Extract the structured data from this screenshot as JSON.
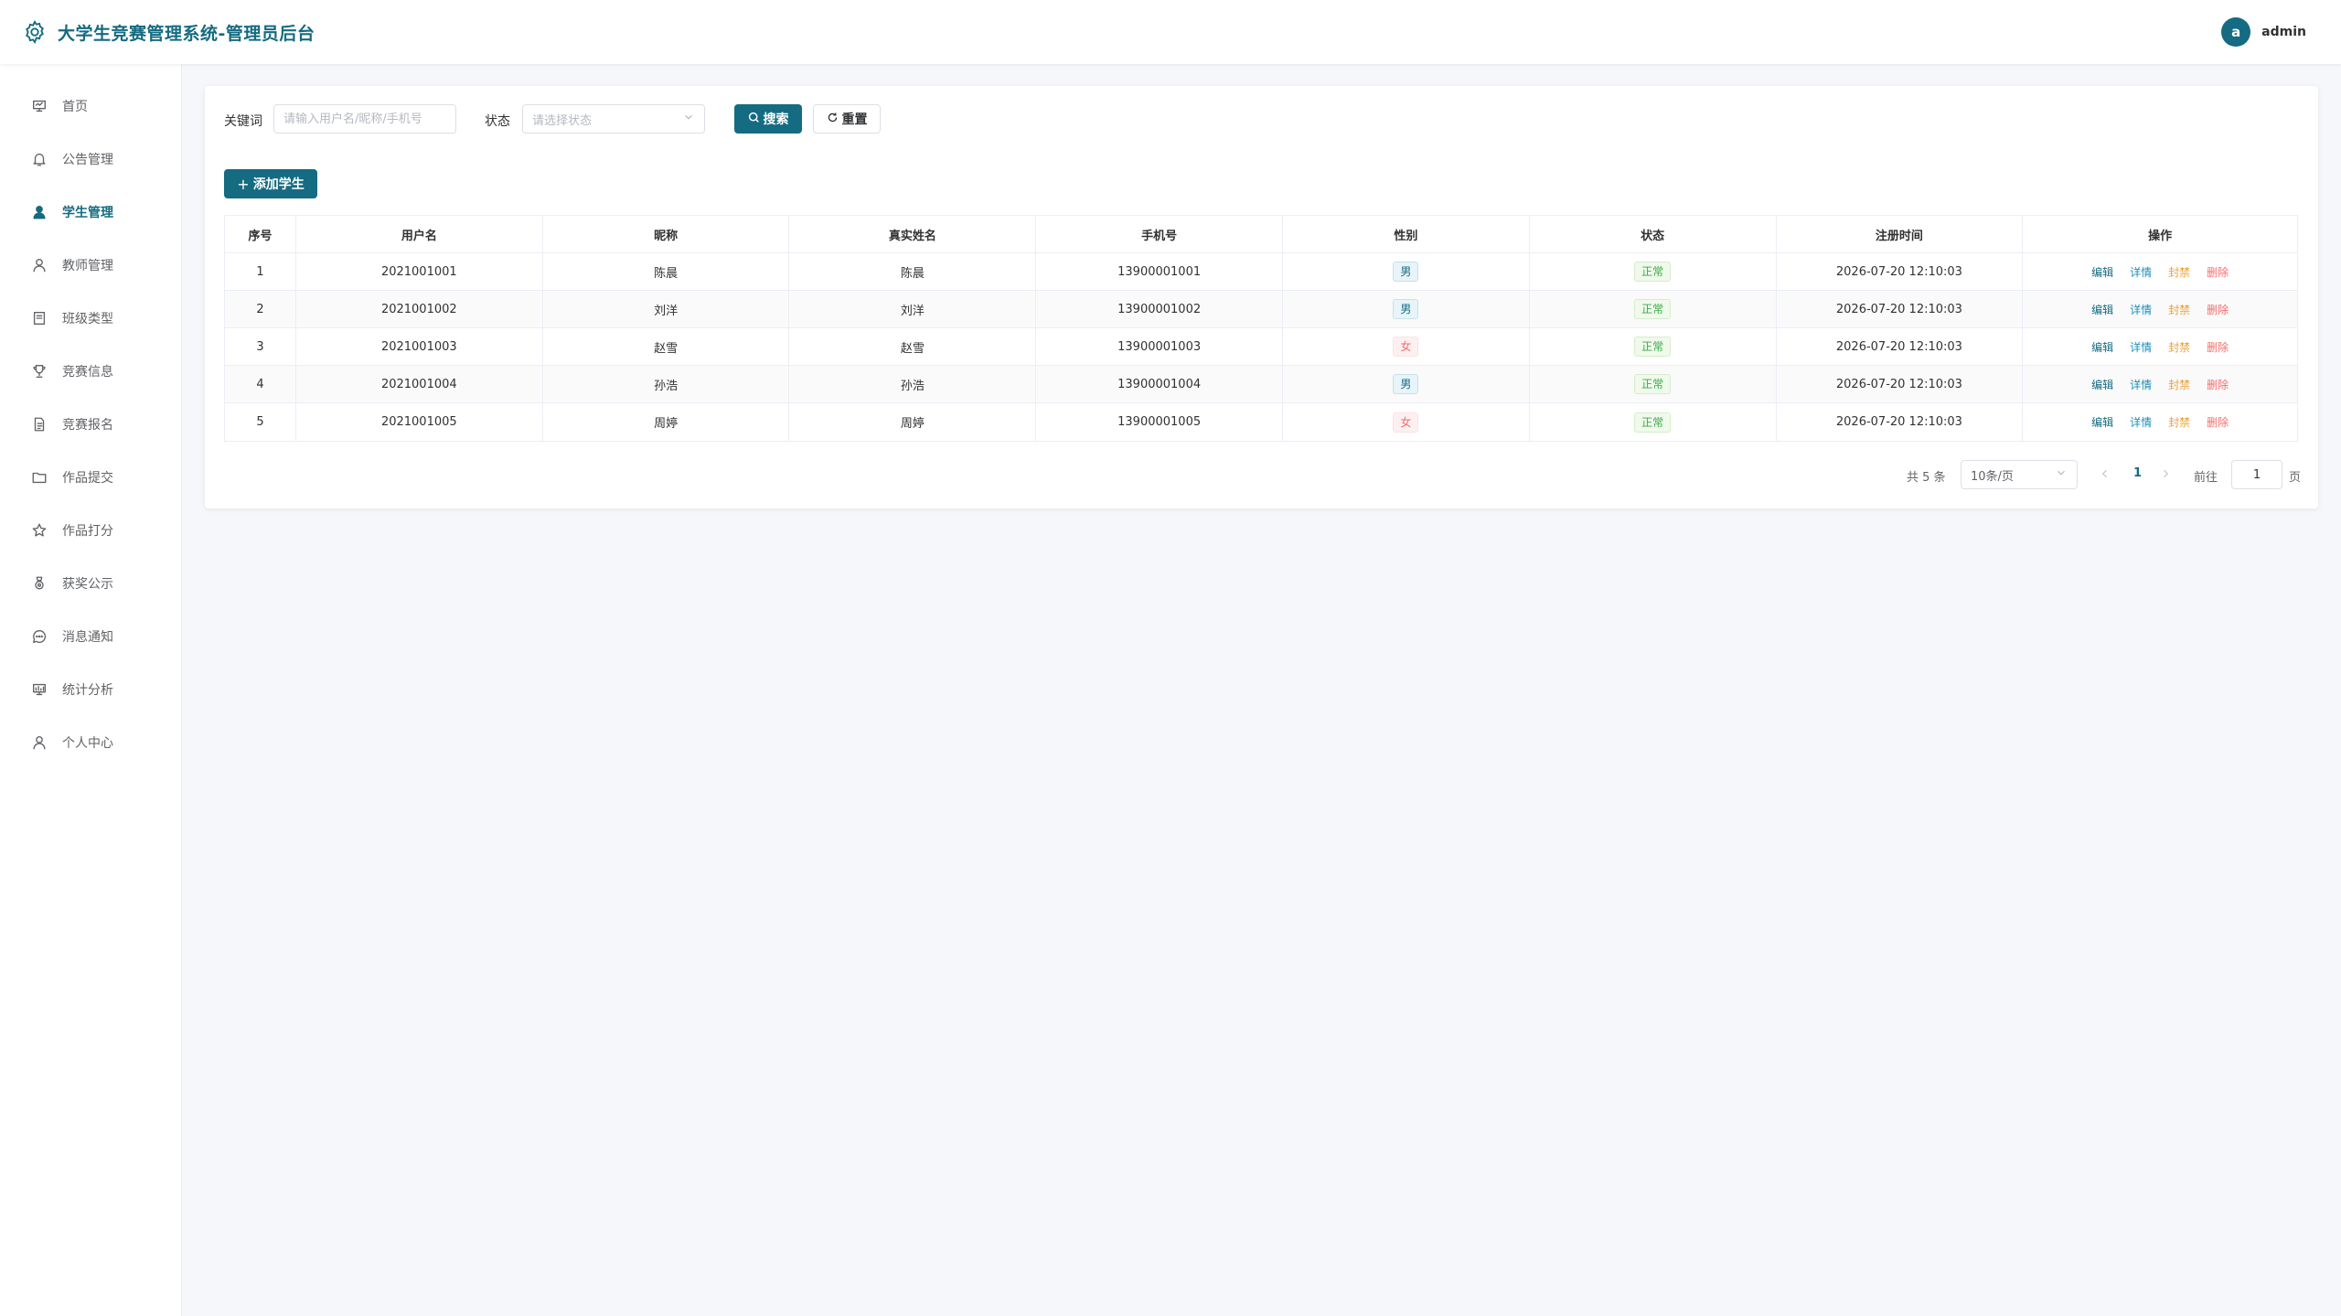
{
  "header": {
    "title": "大学生竞赛管理系统-管理员后台",
    "user_initial": "a",
    "user_name": "admin"
  },
  "sidebar": {
    "active_index": 2,
    "items": [
      {
        "label": "首页",
        "icon": "home-icon"
      },
      {
        "label": "公告管理",
        "icon": "bell-icon"
      },
      {
        "label": "学生管理",
        "icon": "user-filled-icon"
      },
      {
        "label": "教师管理",
        "icon": "user-icon"
      },
      {
        "label": "班级类型",
        "icon": "notebook-icon"
      },
      {
        "label": "竞赛信息",
        "icon": "trophy-icon"
      },
      {
        "label": "竞赛报名",
        "icon": "document-icon"
      },
      {
        "label": "作品提交",
        "icon": "folder-icon"
      },
      {
        "label": "作品打分",
        "icon": "star-icon"
      },
      {
        "label": "获奖公示",
        "icon": "medal-icon"
      },
      {
        "label": "消息通知",
        "icon": "chat-icon"
      },
      {
        "label": "统计分析",
        "icon": "chart-icon"
      },
      {
        "label": "个人中心",
        "icon": "user-icon"
      }
    ]
  },
  "filters": {
    "keyword_label": "关键词",
    "keyword_placeholder": "请输入用户名/昵称/手机号",
    "status_label": "状态",
    "status_placeholder": "请选择状态",
    "search_label": "搜索",
    "reset_label": "重置"
  },
  "add_button_label": "添加学生",
  "table": {
    "columns": [
      "序号",
      "用户名",
      "昵称",
      "真实姓名",
      "手机号",
      "性别",
      "状态",
      "注册时间",
      "操作"
    ],
    "rows": [
      {
        "index": "1",
        "username": "2021001001",
        "nickname": "陈晨",
        "realname": "陈晨",
        "phone": "13900001001",
        "gender": "男",
        "status": "正常",
        "registered": "2026-07-20 12:10:03"
      },
      {
        "index": "2",
        "username": "2021001002",
        "nickname": "刘洋",
        "realname": "刘洋",
        "phone": "13900001002",
        "gender": "男",
        "status": "正常",
        "registered": "2026-07-20 12:10:03"
      },
      {
        "index": "3",
        "username": "2021001003",
        "nickname": "赵雪",
        "realname": "赵雪",
        "phone": "13900001003",
        "gender": "女",
        "status": "正常",
        "registered": "2026-07-20 12:10:03"
      },
      {
        "index": "4",
        "username": "2021001004",
        "nickname": "孙浩",
        "realname": "孙浩",
        "phone": "13900001004",
        "gender": "男",
        "status": "正常",
        "registered": "2026-07-20 12:10:03"
      },
      {
        "index": "5",
        "username": "2021001005",
        "nickname": "周婷",
        "realname": "周婷",
        "phone": "13900001005",
        "gender": "女",
        "status": "正常",
        "registered": "2026-07-20 12:10:03"
      }
    ],
    "actions": {
      "edit": "编辑",
      "detail": "详情",
      "ban": "封禁",
      "delete": "删除"
    }
  },
  "pagination": {
    "total_text": "共 5 条",
    "page_size": "10条/页",
    "current_page": "1",
    "goto_label": "前往",
    "goto_value": "1",
    "page_suffix": "页"
  },
  "colors": {
    "primary": "#146b82",
    "male_tag": "#146b82",
    "female_tag": "#f56c6c",
    "status_ok": "#3bab4a",
    "ban_action": "#e6a23c",
    "delete_action": "#f56c6c"
  }
}
